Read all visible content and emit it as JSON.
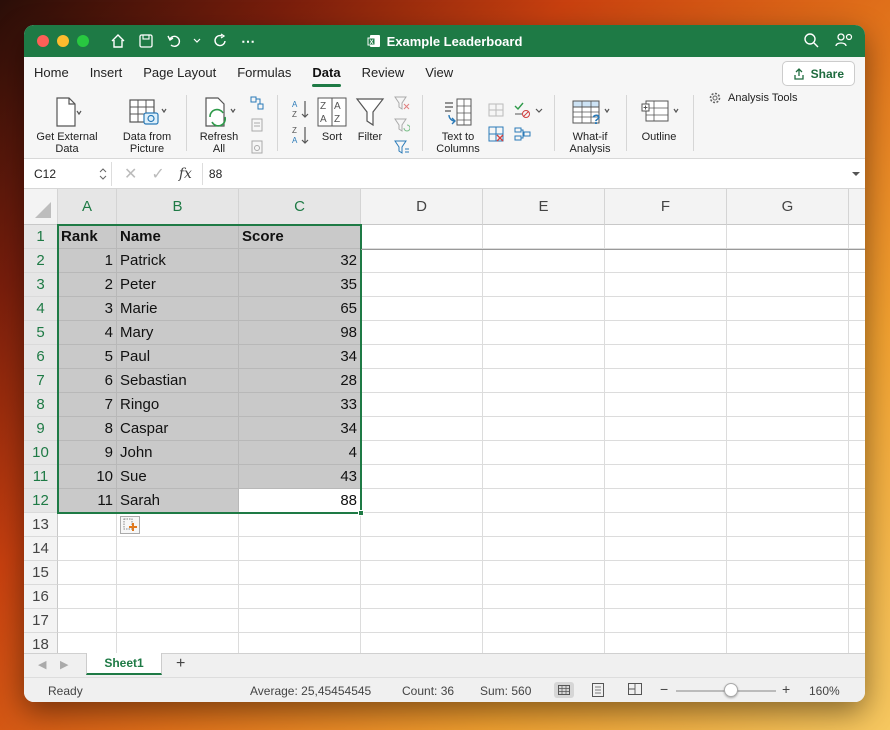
{
  "window": {
    "title": "Example Leaderboard"
  },
  "tabs": [
    "Home",
    "Insert",
    "Page Layout",
    "Formulas",
    "Data",
    "Review",
    "View"
  ],
  "active_tab": "Data",
  "share_label": "Share",
  "ribbon": {
    "get_external_data": "Get External Data",
    "data_from_picture": "Data from Picture",
    "refresh_all": "Refresh All",
    "sort": "Sort",
    "filter": "Filter",
    "text_to_columns": "Text to Columns",
    "what_if": "What-if Analysis",
    "outline": "Outline",
    "analysis_tools": "Analysis Tools"
  },
  "formula_bar": {
    "name_box": "C12",
    "fx": "fx",
    "value": "88"
  },
  "columns": [
    "A",
    "B",
    "C",
    "D",
    "E",
    "F",
    "G"
  ],
  "rows": [
    "1",
    "2",
    "3",
    "4",
    "5",
    "6",
    "7",
    "8",
    "9",
    "10",
    "11",
    "12",
    "13",
    "14",
    "15",
    "16",
    "17",
    "18"
  ],
  "table": {
    "headers": [
      "Rank",
      "Name",
      "Score"
    ],
    "data": [
      [
        "1",
        "Patrick",
        "32"
      ],
      [
        "2",
        "Peter",
        "35"
      ],
      [
        "3",
        "Marie",
        "65"
      ],
      [
        "4",
        "Mary",
        "98"
      ],
      [
        "5",
        "Paul",
        "34"
      ],
      [
        "6",
        "Sebastian",
        "28"
      ],
      [
        "7",
        "Ringo",
        "33"
      ],
      [
        "8",
        "Caspar",
        "34"
      ],
      [
        "9",
        "John",
        "4"
      ],
      [
        "10",
        "Sue",
        "43"
      ],
      [
        "11",
        "Sarah",
        "88"
      ]
    ]
  },
  "sheet_tab": "Sheet1",
  "status": {
    "mode": "Ready",
    "average": "Average: 25,45454545",
    "count": "Count: 36",
    "sum": "Sum: 560",
    "zoom": "160%",
    "zoom_level": 0.55
  },
  "colors": {
    "accent": "#1e7a45",
    "selection_fill": "#c9c9c9"
  }
}
